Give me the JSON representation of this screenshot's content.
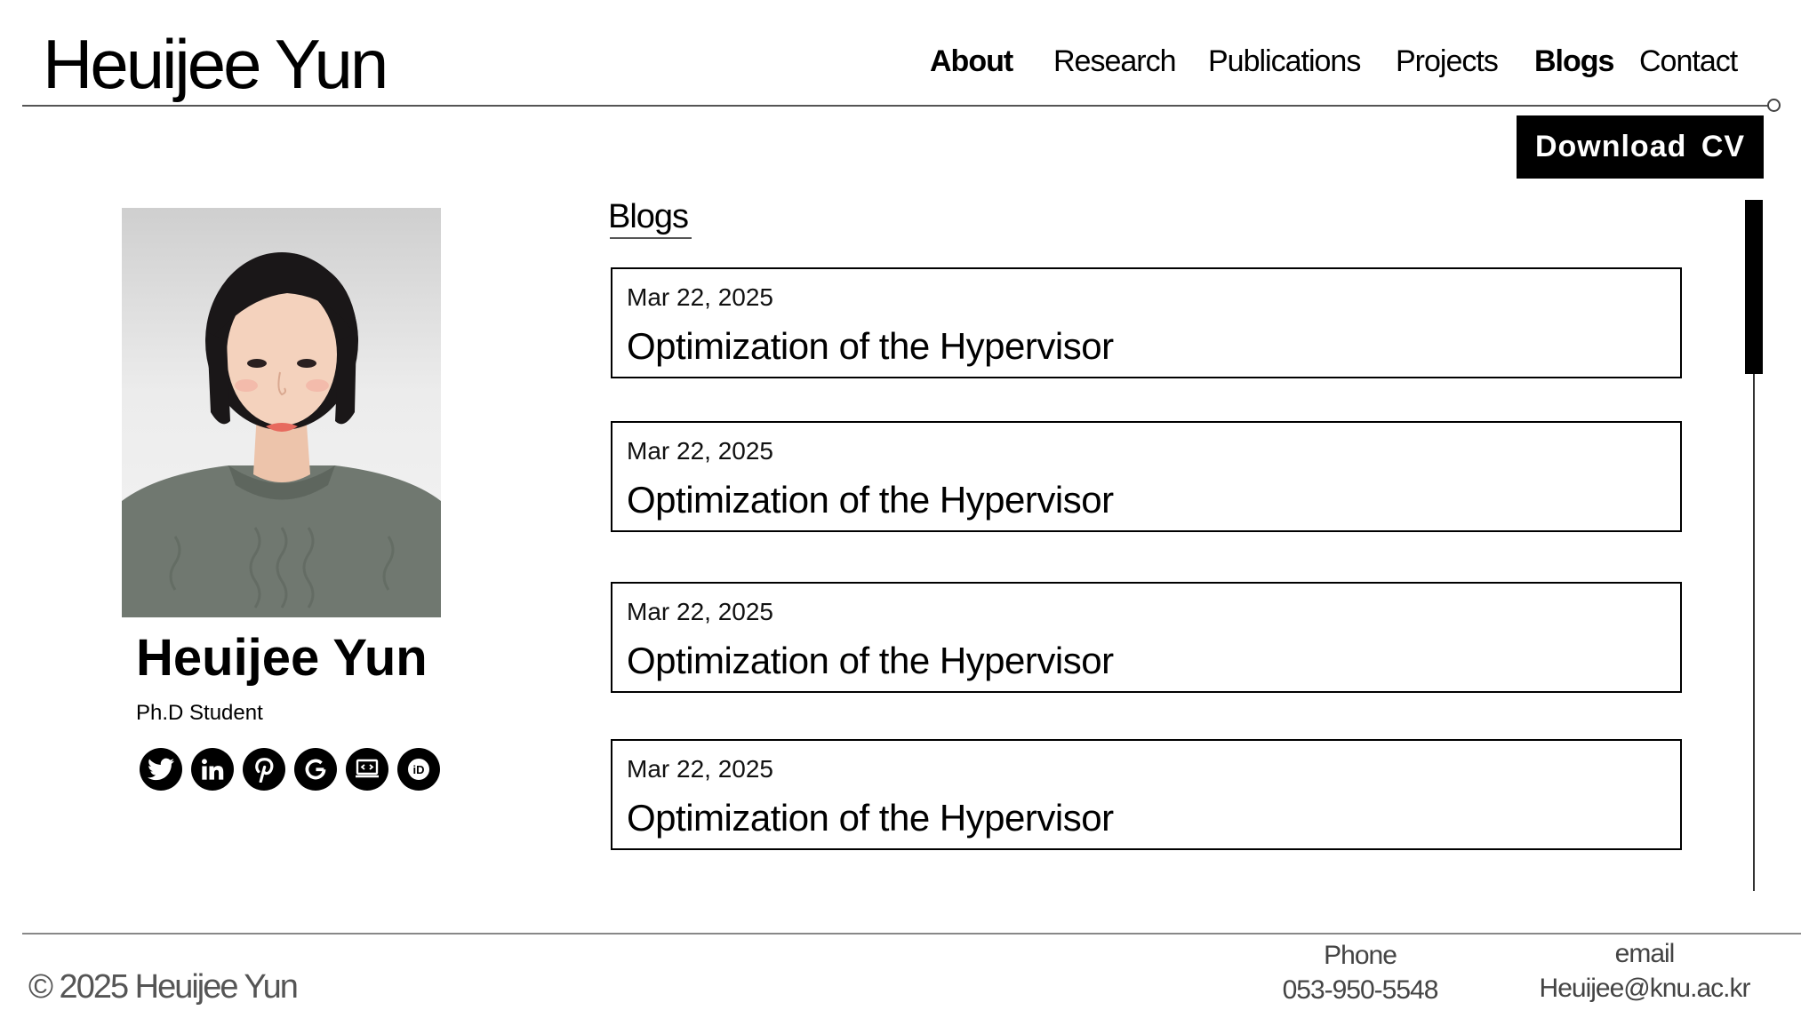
{
  "site": {
    "title": "Heuijee Yun"
  },
  "nav": {
    "items": [
      {
        "label": "About"
      },
      {
        "label": "Research"
      },
      {
        "label": "Publications"
      },
      {
        "label": "Projects"
      },
      {
        "label": "Blogs"
      },
      {
        "label": "Contact"
      }
    ]
  },
  "actions": {
    "download_cv": "Download CV"
  },
  "profile": {
    "name": "Heuijee Yun",
    "role": "Ph.D Student",
    "socials": [
      "twitter-icon",
      "linkedin-icon",
      "pinterest-icon",
      "google-scholar-icon",
      "website-icon",
      "orcid-icon"
    ]
  },
  "blogs": {
    "section_title": "Blogs",
    "posts": [
      {
        "date": "Mar 22, 2025",
        "title": "Optimization of the Hypervisor"
      },
      {
        "date": "Mar 22, 2025",
        "title": "Optimization of the Hypervisor"
      },
      {
        "date": "Mar 22, 2025",
        "title": "Optimization of the Hypervisor"
      },
      {
        "date": "Mar 22, 2025",
        "title": "Optimization of the Hypervisor"
      }
    ]
  },
  "footer": {
    "copyright": "© 2025 Heuijee Yun",
    "phone_label": "Phone",
    "phone_value": "053-950-5548",
    "email_label": "email",
    "email_value": "Heuijee@knu.ac.kr"
  },
  "colors": {
    "text": "#000000",
    "background": "#ffffff",
    "button_bg": "#000000",
    "button_text": "#ffffff",
    "footer_text": "#444444"
  }
}
